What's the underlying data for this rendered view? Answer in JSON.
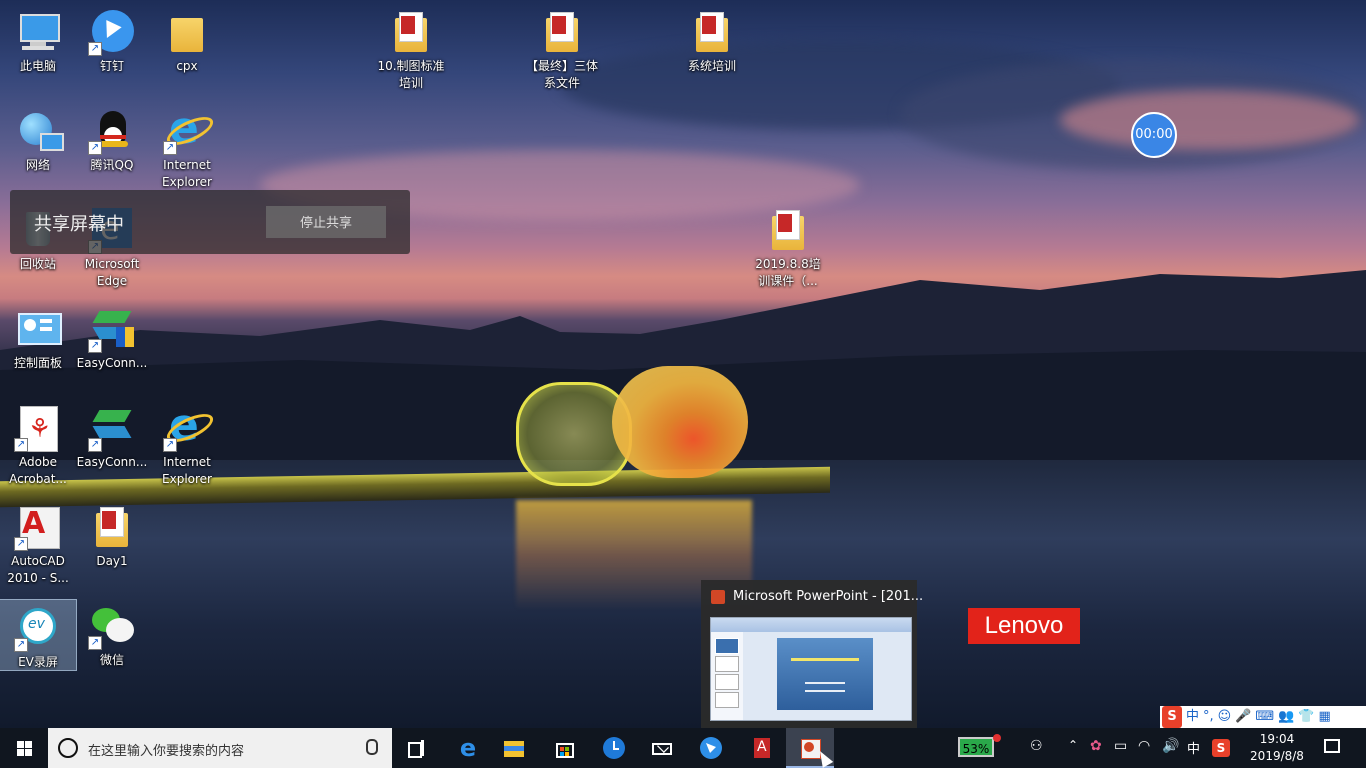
{
  "desktop": {
    "icons": [
      {
        "label": "此电脑",
        "icon": "computer-icon"
      },
      {
        "label": "钉钉",
        "icon": "dingtalk-icon"
      },
      {
        "label": "cpx",
        "icon": "folder-icon"
      },
      {
        "label": "10.制图标准培训",
        "icon": "folder-icon"
      },
      {
        "label": "【最终】三体系文件",
        "icon": "folder-icon"
      },
      {
        "label": "系统培训",
        "icon": "folder-icon"
      },
      {
        "label": "网络",
        "icon": "network-icon"
      },
      {
        "label": "腾讯QQ",
        "icon": "qq-icon"
      },
      {
        "label": "Internet Explorer",
        "icon": "ie-icon"
      },
      {
        "label": "回收站",
        "icon": "recycle-bin-icon"
      },
      {
        "label": "Microsoft Edge",
        "icon": "edge-icon"
      },
      {
        "label": "2019.8.8培训课件（...",
        "icon": "folder-icon"
      },
      {
        "label": "控制面板",
        "icon": "control-panel-icon"
      },
      {
        "label": "EasyConn...",
        "icon": "easyconnect-icon"
      },
      {
        "label": "Adobe Acrobat...",
        "icon": "acrobat-icon"
      },
      {
        "label": "EasyConn...",
        "icon": "easyconnect-icon"
      },
      {
        "label": "Internet Explorer",
        "icon": "ie-icon"
      },
      {
        "label": "AutoCAD 2010 - S...",
        "icon": "autocad-icon"
      },
      {
        "label": "Day1",
        "icon": "folder-icon"
      },
      {
        "label": "EV录屏",
        "icon": "ev-recorder-icon"
      },
      {
        "label": "微信",
        "icon": "wechat-icon"
      }
    ]
  },
  "share_banner": {
    "title": "共享屏幕中",
    "stop_label": "停止共享"
  },
  "timer": {
    "value": "00:00"
  },
  "brand": {
    "text": "Lenovo"
  },
  "preview": {
    "title": "Microsoft PowerPoint - [201..."
  },
  "ime": {
    "brand": "S",
    "mode": "中",
    "punct": "°,"
  },
  "taskbar": {
    "search_placeholder": "在这里输入你要搜索的内容",
    "apps": [
      {
        "name": "task-view",
        "icon": "task-view-icon"
      },
      {
        "name": "edge",
        "icon": "edge-icon"
      },
      {
        "name": "file-explorer",
        "icon": "folder-icon"
      },
      {
        "name": "store",
        "icon": "store-icon"
      },
      {
        "name": "clock-app",
        "icon": "clock-icon"
      },
      {
        "name": "mail",
        "icon": "mail-icon"
      },
      {
        "name": "dingtalk",
        "icon": "dingtalk-icon"
      },
      {
        "name": "acrobat",
        "icon": "acrobat-icon"
      },
      {
        "name": "powerpoint",
        "icon": "powerpoint-icon"
      }
    ],
    "battery_percent": "53%",
    "ime_indicator": "中",
    "time": "19:04",
    "date": "2019/8/8"
  },
  "colors": {
    "taskbar": "#10161f",
    "accent": "#3a86e6",
    "lenovo_red": "#e2231a"
  }
}
